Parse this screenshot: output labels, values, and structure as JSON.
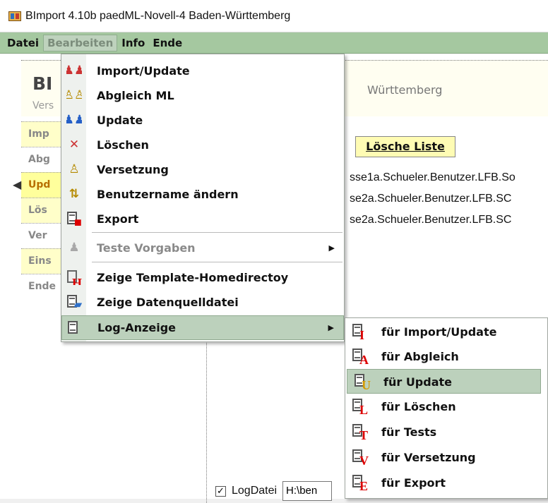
{
  "window": {
    "title": "BImport 4.10b  paedML-Novell-4 Baden-Württemberg",
    "icon": "app-icon"
  },
  "menubar": {
    "items": [
      "Datei",
      "Bearbeiten",
      "Info",
      "Ende"
    ],
    "active": "Bearbeiten"
  },
  "header": {
    "title": "BI",
    "subtitle": "Vers",
    "trailing": "Württemberg"
  },
  "sidebar": {
    "items": [
      "Imp",
      "Abg",
      "Upd",
      "Lös",
      "Ver",
      "Eins",
      "Ende"
    ]
  },
  "toolbar": {
    "delete_list_label": "Lösche Liste"
  },
  "content": {
    "lines": [
      "sse1a.Schueler.Benutzer.LFB.So",
      "se2a.Schueler.Benutzer.LFB.SC",
      "se2a.Schueler.Benutzer.LFB.SC"
    ]
  },
  "footer": {
    "logfile_checked": true,
    "logfile_label": "LogDatei",
    "path_value": "H:\\ben"
  },
  "edit_menu": {
    "items": [
      {
        "label": "Import/Update",
        "icon": "user-sync-icon",
        "enabled": true,
        "submenu": false
      },
      {
        "label": "Abgleich ML",
        "icon": "user-compare-icon",
        "enabled": true,
        "submenu": false
      },
      {
        "label": "Update",
        "icon": "user-update-icon",
        "enabled": true,
        "submenu": false
      },
      {
        "label": "Löschen",
        "icon": "user-delete-icon",
        "enabled": true,
        "submenu": false
      },
      {
        "label": "Versetzung",
        "icon": "user-move-icon",
        "enabled": true,
        "submenu": false
      },
      {
        "label": "Benutzername ändern",
        "icon": "rename-user-icon",
        "enabled": true,
        "submenu": false
      },
      {
        "label": "Export",
        "icon": "export-icon",
        "enabled": true,
        "submenu": false
      },
      {
        "label": "Teste Vorgaben",
        "icon": "test-settings-icon",
        "enabled": false,
        "submenu": true
      },
      {
        "label": "Zeige Template-Homedirectoy",
        "icon": "template-home-icon",
        "enabled": true,
        "submenu": false
      },
      {
        "label": "Zeige Datenquelldatei",
        "icon": "data-source-icon",
        "enabled": true,
        "submenu": false
      },
      {
        "label": "Log-Anzeige",
        "icon": "log-icon",
        "enabled": true,
        "submenu": true,
        "hover": true
      }
    ]
  },
  "log_submenu": {
    "items": [
      {
        "label": "für Import/Update",
        "icon": "log-import-icon",
        "letter": "I",
        "color": "#d00000"
      },
      {
        "label": "für Abgleich",
        "icon": "log-compare-icon",
        "letter": "A",
        "color": "#d00000"
      },
      {
        "label": "für Update",
        "icon": "log-update-icon",
        "letter": "U",
        "color": "#d49a00",
        "hover": true
      },
      {
        "label": "für Löschen",
        "icon": "log-delete-icon",
        "letter": "L",
        "color": "#d00000"
      },
      {
        "label": "für Tests",
        "icon": "log-tests-icon",
        "letter": "T",
        "color": "#d00000"
      },
      {
        "label": "für Versetzung",
        "icon": "log-move-icon",
        "letter": "V",
        "color": "#d00000"
      },
      {
        "label": "für Export",
        "icon": "log-export-icon",
        "letter": "E",
        "color": "#d00000"
      }
    ]
  }
}
